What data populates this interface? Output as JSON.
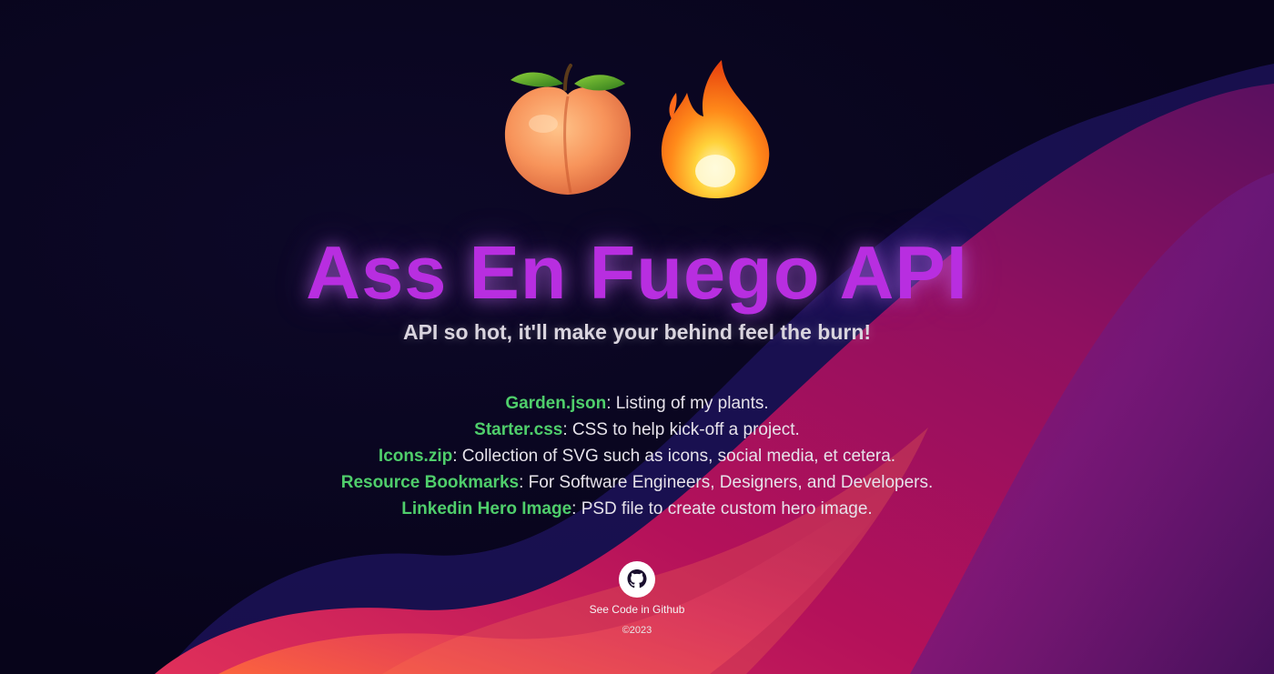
{
  "hero": {
    "emojis": [
      "peach-icon",
      "fire-icon"
    ],
    "title": "Ass En Fuego API",
    "subtitle": "API so hot, it'll make your behind feel the burn!"
  },
  "resources": [
    {
      "name": "Garden.json",
      "description": ": Listing of my plants."
    },
    {
      "name": "Starter.css",
      "description": ": CSS to help kick-off a project."
    },
    {
      "name": "Icons.zip",
      "description": ": Collection of SVG such as icons, social media, et cetera."
    },
    {
      "name": "Resource Bookmarks",
      "description": ": For Software Engineers, Designers, and Developers."
    },
    {
      "name": "Linkedin Hero Image",
      "description": ": PSD file to create custom hero image."
    }
  ],
  "footer": {
    "github_icon": "github-icon",
    "github_label": "See Code in Github",
    "copyright": "©2023"
  },
  "colors": {
    "background": "#07041a",
    "title": "#b82ee0",
    "link": "#4fce6b",
    "text": "#e6e2ea",
    "wave_magenta": "#c0145a",
    "wave_blue": "#2a1a7a"
  }
}
